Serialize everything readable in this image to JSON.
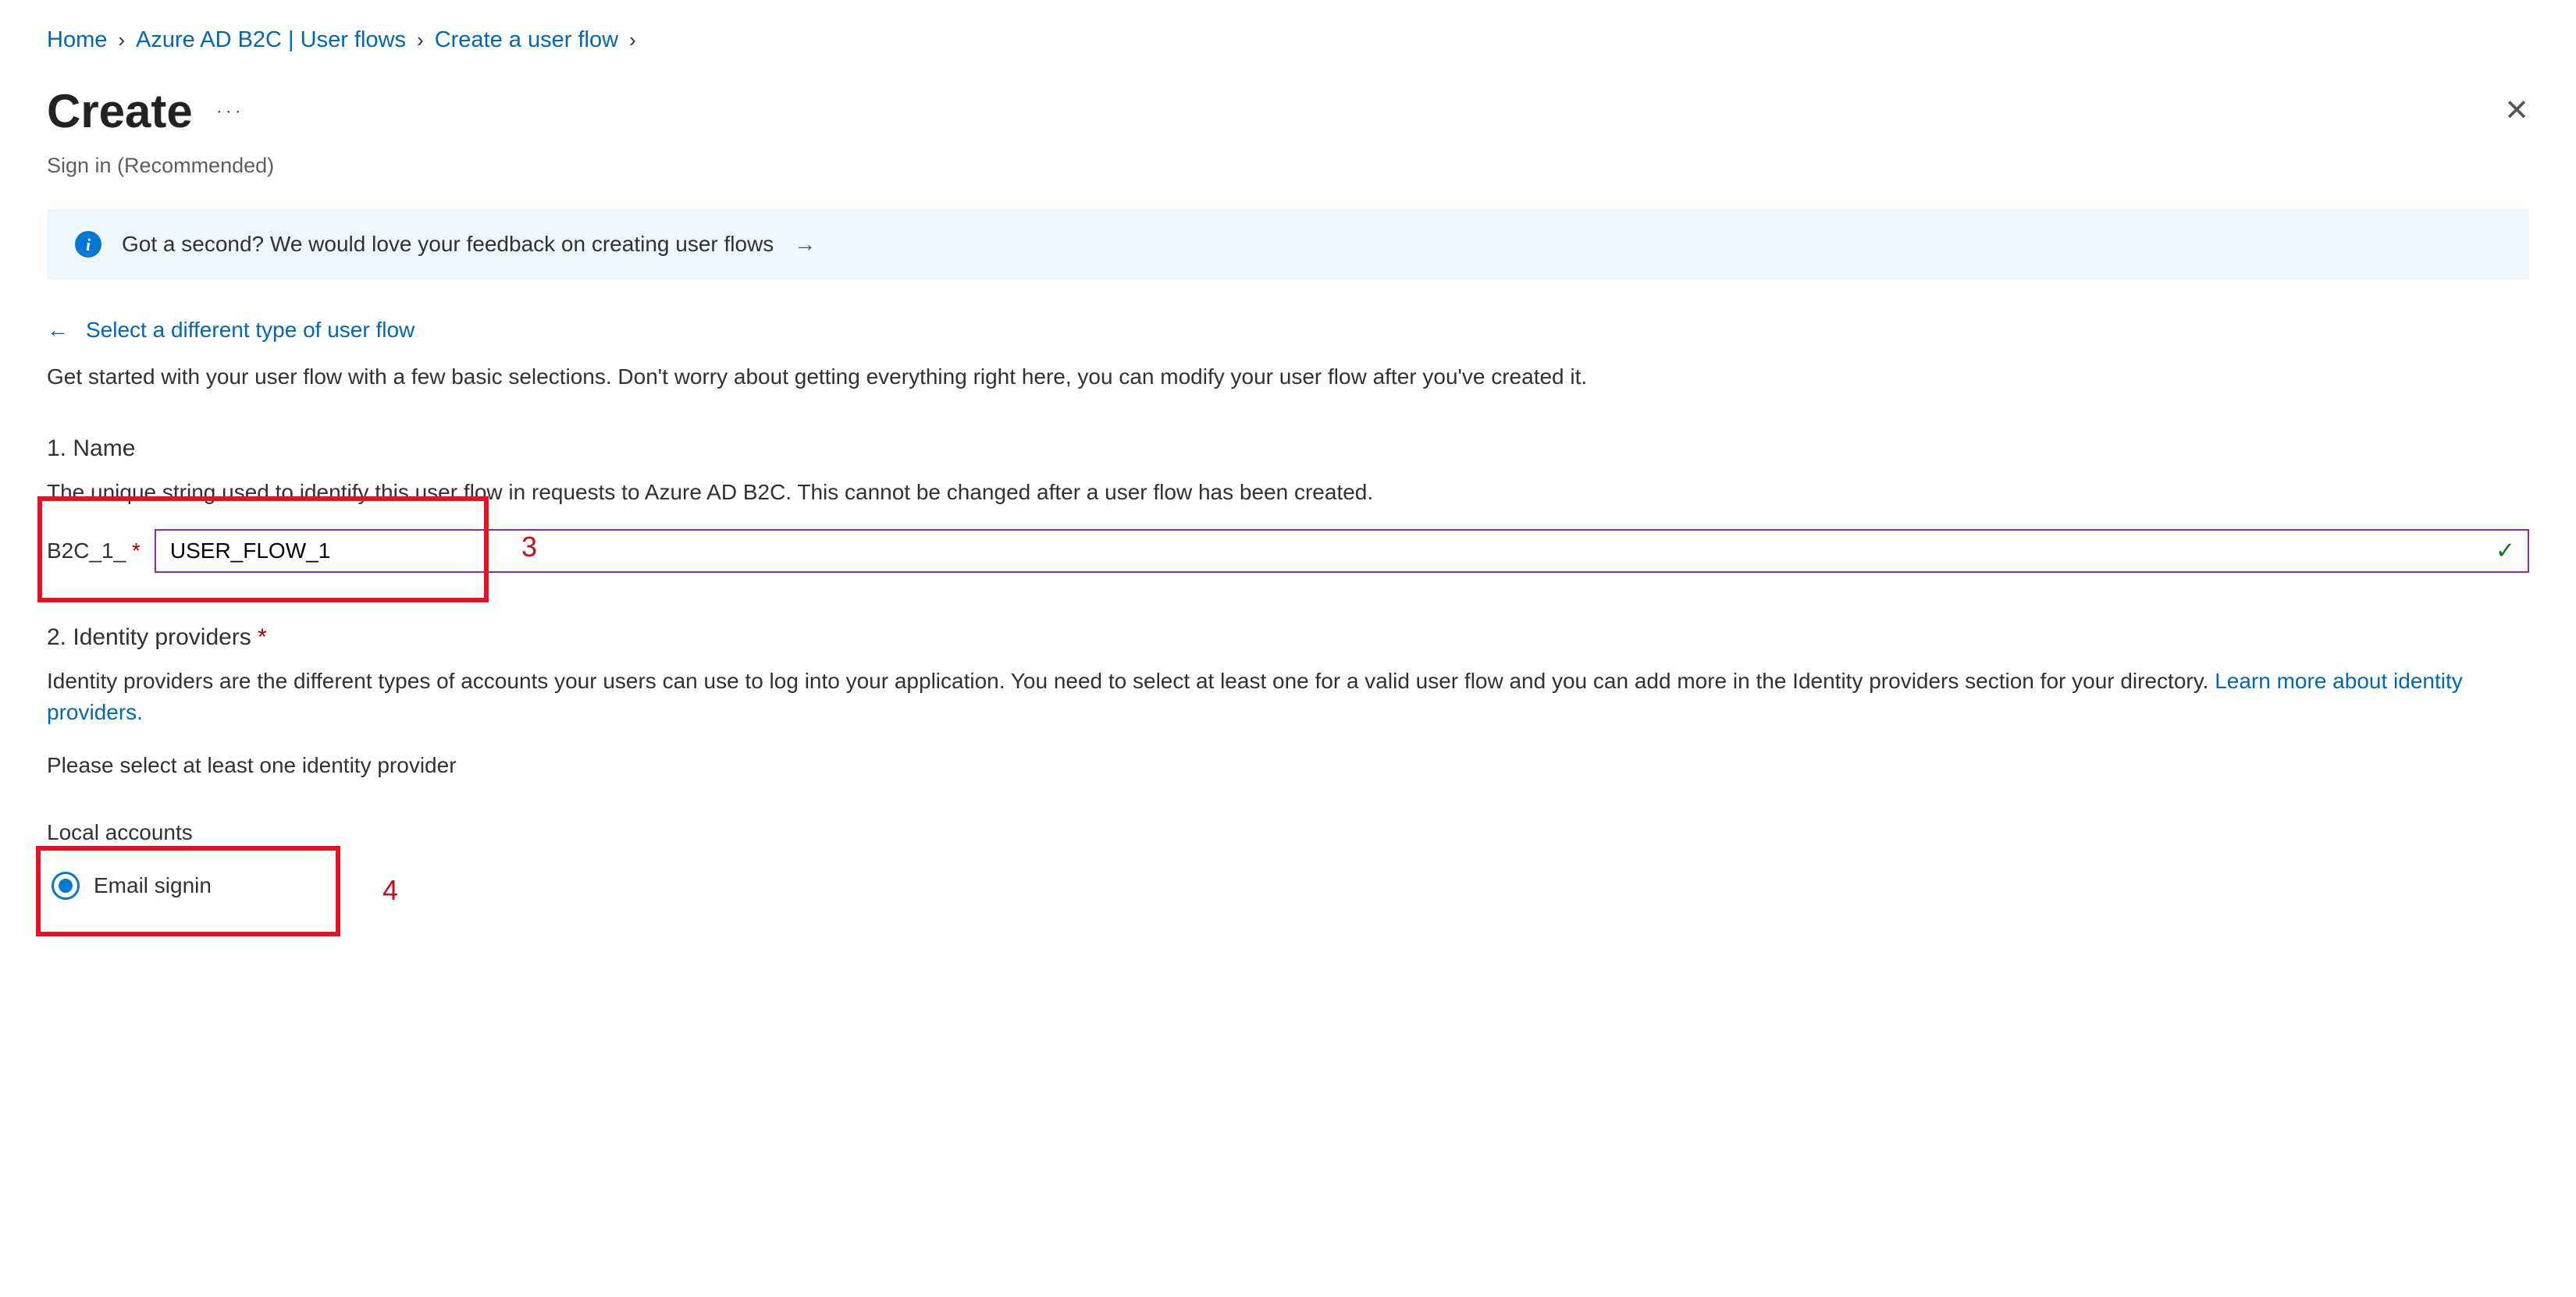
{
  "breadcrumb": {
    "home": "Home",
    "userflows": "Azure AD B2C | User flows",
    "create": "Create a user flow"
  },
  "header": {
    "title": "Create",
    "subtitle": "Sign in (Recommended)"
  },
  "feedback": {
    "text": "Got a second? We would love your feedback on creating user flows"
  },
  "backlink": "Select a different type of user flow",
  "intro": "Get started with your user flow with a few basic selections. Don't worry about getting everything right here, you can modify your user flow after you've created it.",
  "section_name": {
    "heading": "1. Name",
    "description": "The unique string used to identify this user flow in requests to Azure AD B2C. This cannot be changed after a user flow has been created.",
    "prefix": "B2C_1_",
    "value": "USER_FLOW_1"
  },
  "section_idp": {
    "heading": "2. Identity providers",
    "description_pre": "Identity providers are the different types of accounts your users can use to log into your application. You need to select at least one for a valid user flow and you can add more in the Identity providers section for your directory. ",
    "learn_more": "Learn more about identity providers.",
    "instruction": "Please select at least one identity provider",
    "local_accounts_label": "Local accounts",
    "option_email": "Email signin"
  },
  "annotations": {
    "step3": "3",
    "step4": "4"
  }
}
